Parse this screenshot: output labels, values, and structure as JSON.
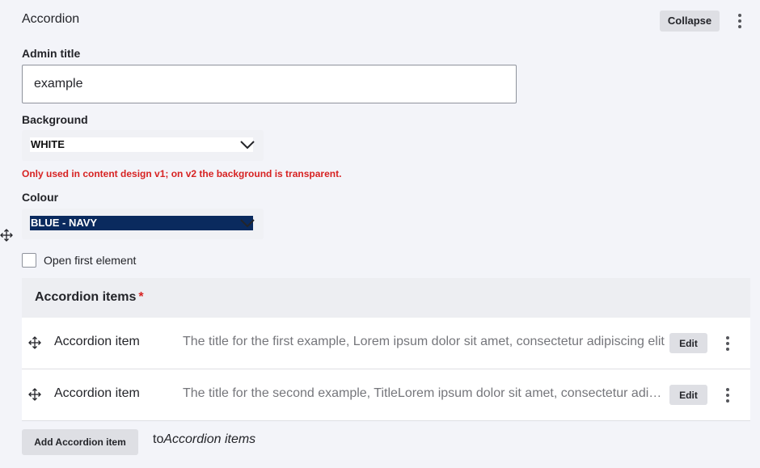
{
  "paragraph": {
    "title": "Accordion",
    "collapse_label": "Collapse"
  },
  "admin_title": {
    "label": "Admin title",
    "value": "example"
  },
  "background": {
    "label": "Background",
    "selected": "WHITE",
    "warning": "Only used in content design v1; on v2 the background is transparent."
  },
  "colour": {
    "label": "Colour",
    "selected": "BLUE - NAVY"
  },
  "open_first": {
    "label": "Open first element",
    "checked": false
  },
  "items_table": {
    "header": "Accordion items",
    "required_mark": "*",
    "rows": [
      {
        "type": "Accordion item",
        "summary": "The title for the first example, Lorem ipsum dolor sit amet, consectetur adipiscing elit",
        "edit_label": "Edit"
      },
      {
        "type": "Accordion item",
        "summary": "The title for the second example, TitleLorem ipsum dolor sit amet, consectetur adipiscing elit",
        "edit_label": "Edit"
      }
    ]
  },
  "add": {
    "button_label": "Add Accordion item",
    "to_prefix": "to",
    "to_target": "Accordion items"
  },
  "colors": {
    "navy": "#0a2a5e",
    "warning": "#d72222",
    "button_bg": "#dedfe4"
  },
  "icons": [
    "move-icon",
    "kebab-menu-icon",
    "chevron-down-icon",
    "drag-handle-icon"
  ]
}
